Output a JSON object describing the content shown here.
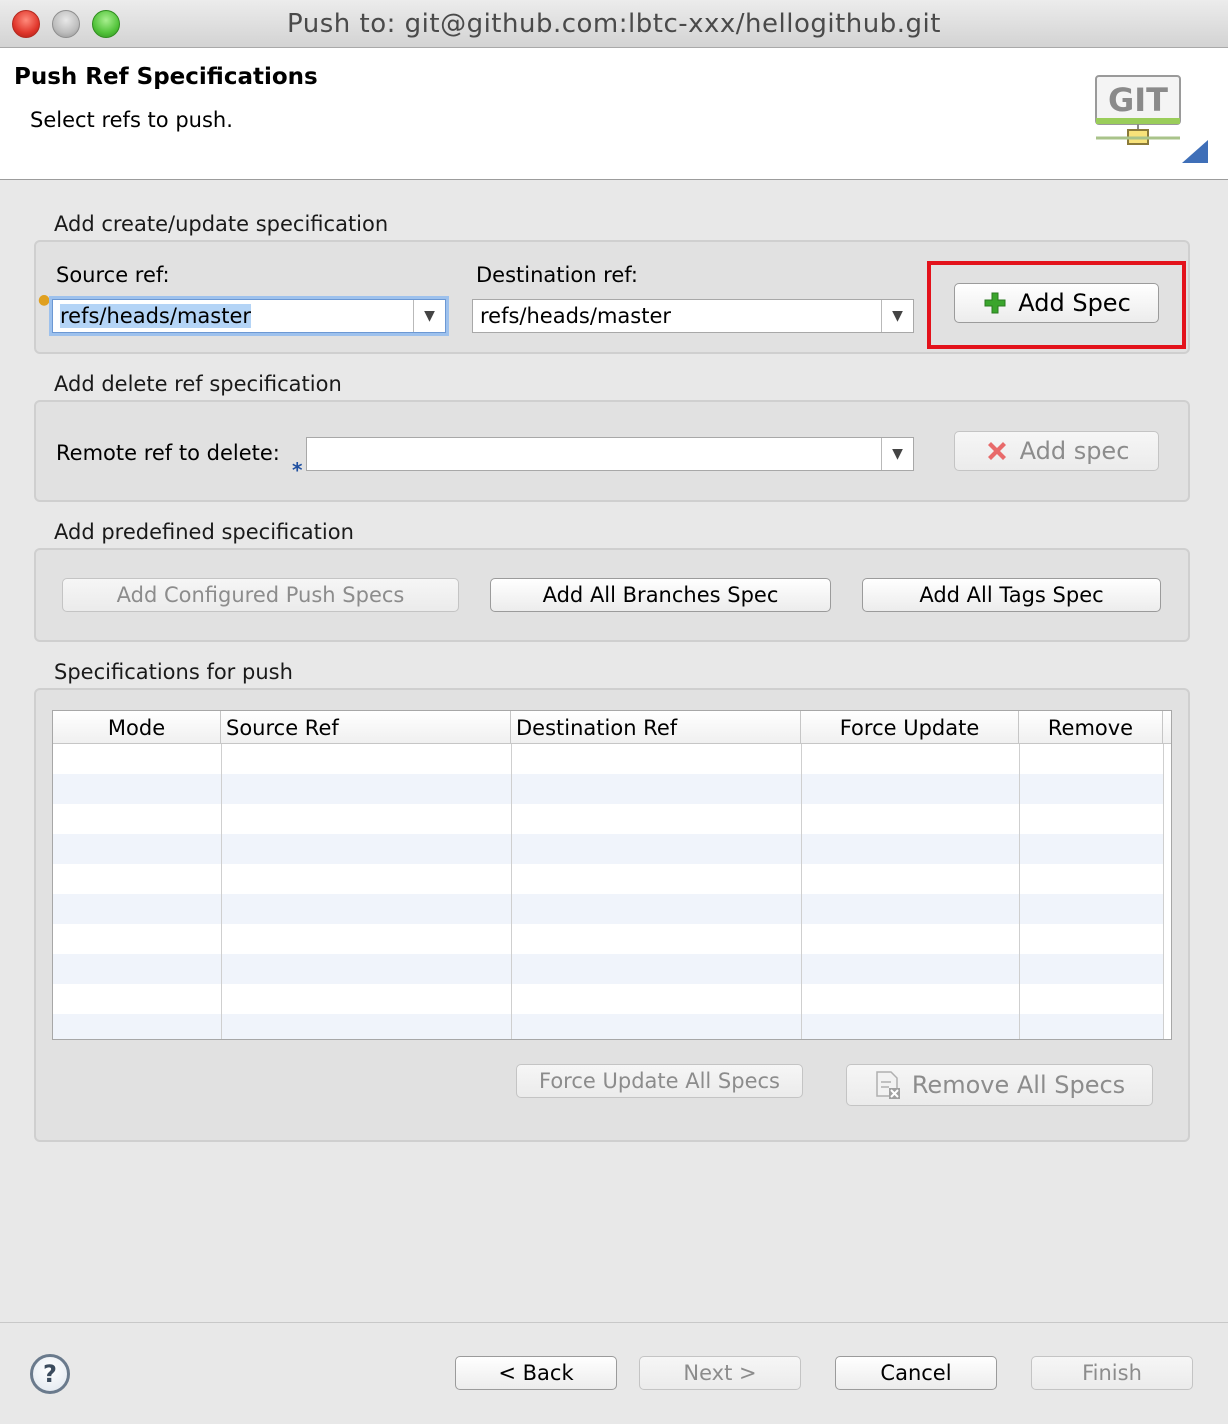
{
  "window": {
    "title": "Push to: git@github.com:lbtc-xxx/hellogithub.git"
  },
  "header": {
    "title": "Push Ref Specifications",
    "description": "Select refs to push.",
    "logo_text": "GIT"
  },
  "create_update": {
    "group_label": "Add create/update specification",
    "source_label": "Source ref:",
    "source_value": "refs/heads/master",
    "destination_label": "Destination ref:",
    "destination_value": "refs/heads/master",
    "add_button": "Add Spec"
  },
  "delete": {
    "group_label": "Add delete ref specification",
    "remote_label": "Remote ref to delete:",
    "remote_value": "",
    "add_button": "Add spec"
  },
  "predefined": {
    "group_label": "Add predefined specification",
    "configured_button": "Add Configured Push Specs",
    "branches_button": "Add All Branches Spec",
    "tags_button": "Add All Tags Spec"
  },
  "specs": {
    "group_label": "Specifications for push",
    "columns": [
      "Mode",
      "Source Ref",
      "Destination Ref",
      "Force Update",
      "Remove"
    ],
    "rows": [],
    "force_update_button": "Force Update All Specs",
    "remove_all_button": "Remove All Specs"
  },
  "footer": {
    "help": "?",
    "back": "< Back",
    "next": "Next >",
    "cancel": "Cancel",
    "finish": "Finish"
  },
  "colors": {
    "highlight": "#e3121b",
    "add_icon": "#3aa52c",
    "delete_icon": "#e86a6a"
  },
  "icons": [
    "help-icon",
    "add-icon",
    "delete-icon",
    "remove-all-icon",
    "git-logo",
    "dropdown-arrow-icon",
    "content-assist-icon"
  ]
}
